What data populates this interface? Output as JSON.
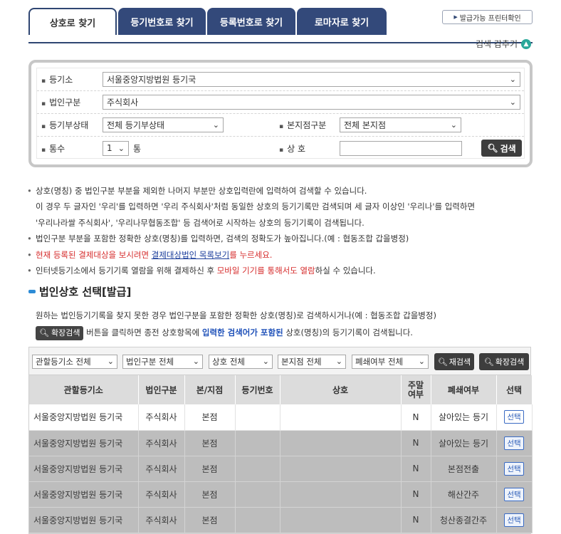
{
  "tabs": [
    {
      "label": "상호로 찾기",
      "active": true
    },
    {
      "label": "등기번호로 찾기",
      "active": false
    },
    {
      "label": "등록번호로 찾기",
      "active": false
    },
    {
      "label": "로마자로 찾기",
      "active": false
    }
  ],
  "print_button": "발급가능 프린터확인",
  "collapse_label": "검색 감추기",
  "search": {
    "registry_label": "등기소",
    "registry_value": "서울중앙지방법원 등기국",
    "corp_type_label": "법인구분",
    "corp_type_value": "주식회사",
    "status_label": "등기부상태",
    "status_value": "전체 등기부상태",
    "branch_label": "본지점구분",
    "branch_value": "전체 본지점",
    "copies_label": "통수",
    "copies_value": "1",
    "copies_unit": "통",
    "name_label": "상 호",
    "name_value": "",
    "search_button": "검색"
  },
  "notes": {
    "line1": "상호(명칭) 중 법인구분 부분을 제외한 나머지 부분만 상호입력란에 입력하여 검색할 수 있습니다.",
    "line2": "이 경우 두 글자인 '우리'를 입력하면 '우리 주식회사'처럼 동일한 상호의 등기기록만 검색되며 세 글자 이상인 '우리나'를 입력하면",
    "line3": "'우리나라쌀 주식회사', '우리나무협동조합' 등 검색어로 시작하는 상호의 등기기록이 검색됩니다.",
    "line4": "법인구분 부분을 포함한 정확한 상호(명칭)를 입력하면, 검색의 정확도가 높아집니다.(예 : 협동조합 갑을병정)",
    "line5_a": "현재 등록된 결제대상을 보시려면 ",
    "line5_link": "결제대상법인 목록보기",
    "line5_b": "를 누르세요.",
    "line6_a": "인터넷등기소에서 등기기록 열람을 위해 결제하신 후 ",
    "line6_red": "모바일 기기를 통해서도 열람",
    "line6_b": "하실 수 있습니다."
  },
  "section_title": "법인상호 선택[발급]",
  "notes2": {
    "line1": "원하는 법인등기기록을 찾지 못한 경우 법인구분을 포함한 정확한 상호(명칭)로 검색하시거나(예 : 협동조합 갑을병정)",
    "btn": "확장검색",
    "line2_a": " 버튼을 클릭하면 종전 상호항목에 ",
    "line2_blue": "입력한 검색어가 포함된",
    "line2_b": " 상호(명칭)의 등기기록이 검색됩니다."
  },
  "filters": {
    "registry": "관할등기소 전체",
    "corp_type": "법인구분 전체",
    "name": "상호 전체",
    "branch": "본지점 전체",
    "closed": "폐쇄여부 전체",
    "research_button": "재검색",
    "extend_button": "확장검색"
  },
  "table": {
    "headers": [
      "관할등기소",
      "법인구분",
      "본/지점",
      "등기번호",
      "상호",
      "주말\n여부",
      "폐쇄여부",
      "선택"
    ],
    "rows": [
      [
        "서울중앙지방법원 등기국",
        "주식회사",
        "본점",
        "",
        "",
        "N",
        "살아있는 등기",
        "선택"
      ],
      [
        "서울중앙지방법원 등기국",
        "주식회사",
        "본점",
        "",
        "",
        "N",
        "살아있는 등기",
        "선택"
      ],
      [
        "서울중앙지방법원 등기국",
        "주식회사",
        "본점",
        "",
        "",
        "N",
        "본점전출",
        "선택"
      ],
      [
        "서울중앙지방법원 등기국",
        "주식회사",
        "본점",
        "",
        "",
        "N",
        "해산간주",
        "선택"
      ],
      [
        "서울중앙지방법원 등기국",
        "주식회사",
        "본점",
        "",
        "",
        "N",
        "청산종결간주",
        "선택"
      ]
    ]
  }
}
